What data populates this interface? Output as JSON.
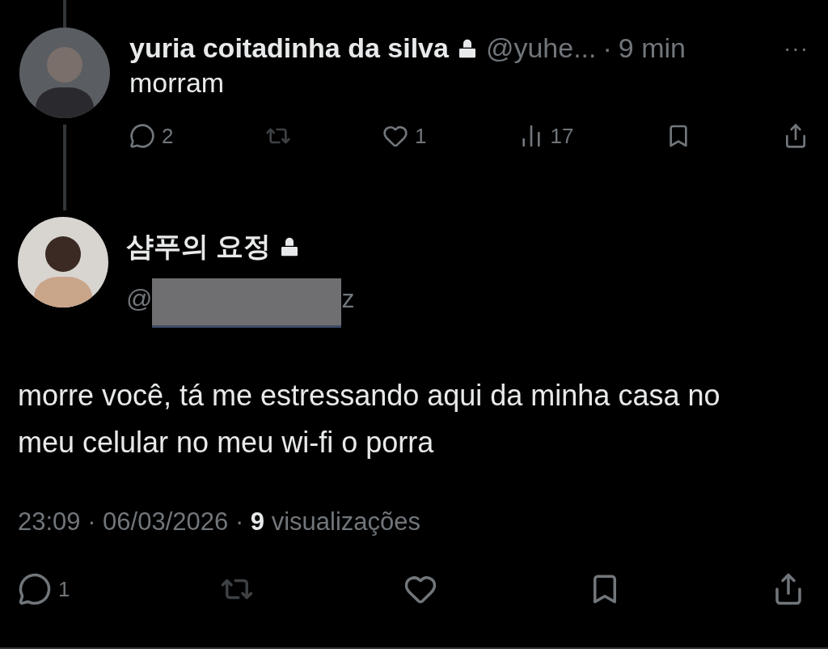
{
  "reply_tweet": {
    "author": "yuria coitadinha da silva",
    "protected": true,
    "handle": "@yuhe...",
    "separator": "·",
    "time": "9 min",
    "more": "···",
    "text": "morram",
    "actions": [
      {
        "kind": "reply",
        "count": "2",
        "disabled": false
      },
      {
        "kind": "repost",
        "disabled": true
      },
      {
        "kind": "like",
        "count": "1",
        "disabled": false
      },
      {
        "kind": "views",
        "count": "17",
        "disabled": false
      },
      {
        "kind": "bookmark",
        "disabled": false
      },
      {
        "kind": "share",
        "disabled": false
      }
    ]
  },
  "main_tweet": {
    "author": "샴푸의 요정",
    "protected": true,
    "handle_start": "@",
    "handle_end": "z",
    "handle_redacted": true,
    "text": "morre você, tá me estressando aqui da minha casa no meu celular no meu wi-fi o porra",
    "timestamp": "23:09 · 06/03/2026 · **9** visualizações",
    "actions": [
      {
        "kind": "reply",
        "count": "1",
        "disabled": false
      },
      {
        "kind": "repost",
        "disabled": true
      },
      {
        "kind": "like",
        "disabled": false
      },
      {
        "kind": "bookmark",
        "disabled": false
      },
      {
        "kind": "share",
        "disabled": false
      }
    ]
  }
}
